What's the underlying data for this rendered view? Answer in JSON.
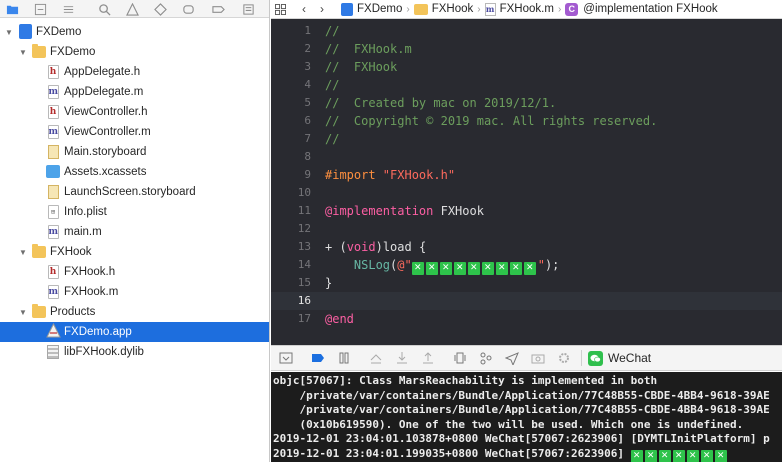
{
  "navigator": {
    "toolbar_icons": [
      "folder-icon",
      "source-control-icon",
      "symbol-icon",
      "search-icon",
      "warning-icon",
      "test-icon",
      "debug-icon",
      "breakpoint-icon",
      "report-icon"
    ],
    "items": [
      {
        "label": "FXDemo",
        "icon": "project-icon",
        "expanded": true
      },
      {
        "label": "FXDemo",
        "icon": "folder-icon",
        "expanded": true
      },
      {
        "label": "AppDelegate.h",
        "icon": "h-file-icon",
        "glyph": "h"
      },
      {
        "label": "AppDelegate.m",
        "icon": "m-file-icon",
        "glyph": "m"
      },
      {
        "label": "ViewController.h",
        "icon": "h-file-icon",
        "glyph": "h"
      },
      {
        "label": "ViewController.m",
        "icon": "m-file-icon",
        "glyph": "m"
      },
      {
        "label": "Main.storyboard",
        "icon": "storyboard-icon"
      },
      {
        "label": "Assets.xcassets",
        "icon": "assets-icon"
      },
      {
        "label": "LaunchScreen.storyboard",
        "icon": "storyboard-icon"
      },
      {
        "label": "Info.plist",
        "icon": "plist-icon",
        "glyph": "⊞"
      },
      {
        "label": "main.m",
        "icon": "m-file-icon",
        "glyph": "m"
      },
      {
        "label": "FXHook",
        "icon": "folder-icon",
        "expanded": true
      },
      {
        "label": "FXHook.h",
        "icon": "h-file-icon",
        "glyph": "h"
      },
      {
        "label": "FXHook.m",
        "icon": "m-file-icon",
        "glyph": "m"
      },
      {
        "label": "Products",
        "icon": "folder-icon",
        "expanded": true
      },
      {
        "label": "FXDemo.app",
        "icon": "app-icon",
        "glyph": "A",
        "selected": true
      },
      {
        "label": "libFXHook.dylib",
        "icon": "dylib-icon"
      }
    ]
  },
  "jumpbar": {
    "crumbs": [
      {
        "label": "FXDemo",
        "icon": "project-icon"
      },
      {
        "label": "FXHook",
        "icon": "folder-icon"
      },
      {
        "label": "FXHook.m",
        "icon": "m-file-icon",
        "glyph": "m"
      },
      {
        "label": "@implementation FXHook",
        "icon": "class-icon",
        "glyph": "C"
      }
    ]
  },
  "code": {
    "current_line": 16,
    "lines": [
      {
        "n": "1",
        "tokens": [
          {
            "t": "//",
            "c": "comment"
          }
        ]
      },
      {
        "n": "2",
        "tokens": [
          {
            "t": "//  FXHook.m",
            "c": "comment"
          }
        ]
      },
      {
        "n": "3",
        "tokens": [
          {
            "t": "//  FXHook",
            "c": "comment"
          }
        ]
      },
      {
        "n": "4",
        "tokens": [
          {
            "t": "//",
            "c": "comment"
          }
        ]
      },
      {
        "n": "5",
        "tokens": [
          {
            "t": "//  Created by mac on 2019/12/1.",
            "c": "comment"
          }
        ]
      },
      {
        "n": "6",
        "tokens": [
          {
            "t": "//  Copyright © 2019 mac. All rights reserved.",
            "c": "comment"
          }
        ]
      },
      {
        "n": "7",
        "tokens": [
          {
            "t": "//",
            "c": "comment"
          }
        ]
      },
      {
        "n": "8",
        "tokens": []
      },
      {
        "n": "9",
        "tokens": [
          {
            "t": "#import ",
            "c": "pre"
          },
          {
            "t": "\"FXHook.h\"",
            "c": "str"
          }
        ]
      },
      {
        "n": "10",
        "tokens": []
      },
      {
        "n": "11",
        "tokens": [
          {
            "t": "@implementation",
            "c": "kw"
          },
          {
            "t": " FXHook",
            "c": "plain"
          }
        ]
      },
      {
        "n": "12",
        "tokens": []
      },
      {
        "n": "13",
        "tokens": [
          {
            "t": "+ (",
            "c": "plain"
          },
          {
            "t": "void",
            "c": "kw"
          },
          {
            "t": ")load {",
            "c": "plain"
          }
        ]
      },
      {
        "n": "14",
        "tokens": [
          {
            "t": "    ",
            "c": "plain"
          },
          {
            "t": "NSLog",
            "c": "fn"
          },
          {
            "t": "(",
            "c": "plain"
          },
          {
            "t": "@\"",
            "c": "str"
          },
          {
            "badges": 9
          },
          {
            "t": "\"",
            "c": "str"
          },
          {
            "t": ");",
            "c": "plain"
          }
        ]
      },
      {
        "n": "15",
        "tokens": [
          {
            "t": "}",
            "c": "plain"
          }
        ]
      },
      {
        "n": "16",
        "tokens": []
      },
      {
        "n": "17",
        "tokens": [
          {
            "t": "@end",
            "c": "kw"
          }
        ]
      }
    ]
  },
  "debugbar": {
    "buttons": [
      "hide-console-icon",
      "breakpoints-toggle-icon",
      "pause-icon",
      "step-over-icon",
      "step-into-icon",
      "step-out-icon",
      "view-hierarchy-icon",
      "memory-graph-icon",
      "location-icon",
      "camera-icon",
      "environment-icon"
    ],
    "target_label": "WeChat"
  },
  "console": {
    "lines": [
      "objc[57067]: Class MarsReachability is implemented in both",
      "    /private/var/containers/Bundle/Application/77C48B55-CBDE-4BB4-9618-39AE",
      "    /private/var/containers/Bundle/Application/77C48B55-CBDE-4BB4-9618-39AE",
      "    (0x10b619590). One of the two will be used. Which one is undefined.",
      "2019-12-01 23:04:01.103878+0800 WeChat[57067:2623906] [DYMTLInitPlatform] p",
      "2019-12-01 23:04:01.199035+0800 WeChat[57067:2623906] "
    ],
    "last_line_badges": 7
  },
  "colors": {
    "editor_bg": "#292a30",
    "comment": "#6c9e5d",
    "keyword": "#fc5fa3",
    "string": "#fc6a5d",
    "preprocessor": "#fd8f3f",
    "selection": "#1d6ede",
    "badge": "#2ec34b"
  }
}
